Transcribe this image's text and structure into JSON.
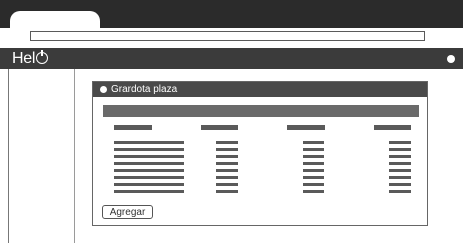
{
  "app": {
    "brand": "Hel"
  },
  "dialog": {
    "title": "Grardota plaza"
  },
  "table": {
    "columns": 4,
    "rows": 8
  },
  "actions": {
    "add_label": "Agregar"
  },
  "colors": {
    "chrome_dark": "#2b2b2b",
    "appbar": "#3b3b3b",
    "dialog_title": "#4a4a4a",
    "bars": "#5a5a5a"
  }
}
